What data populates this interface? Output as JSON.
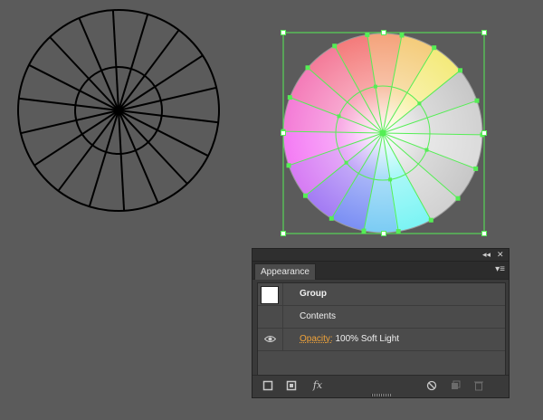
{
  "panel": {
    "tab_label": "Appearance",
    "collapse_glyph": "◂◂",
    "close_glyph": "✕",
    "menu_glyph": "▾≡",
    "rows": {
      "group": {
        "label": "Group"
      },
      "contents": {
        "label": "Contents"
      },
      "opacity": {
        "link_label": "Opacity:",
        "value": "100% Soft Light"
      }
    },
    "toolbar": {
      "fx_label": "fx"
    }
  },
  "colors": {
    "background": "#5b5b5b",
    "selection": "#55ee55",
    "opacity_link": "#f0a33a"
  }
}
